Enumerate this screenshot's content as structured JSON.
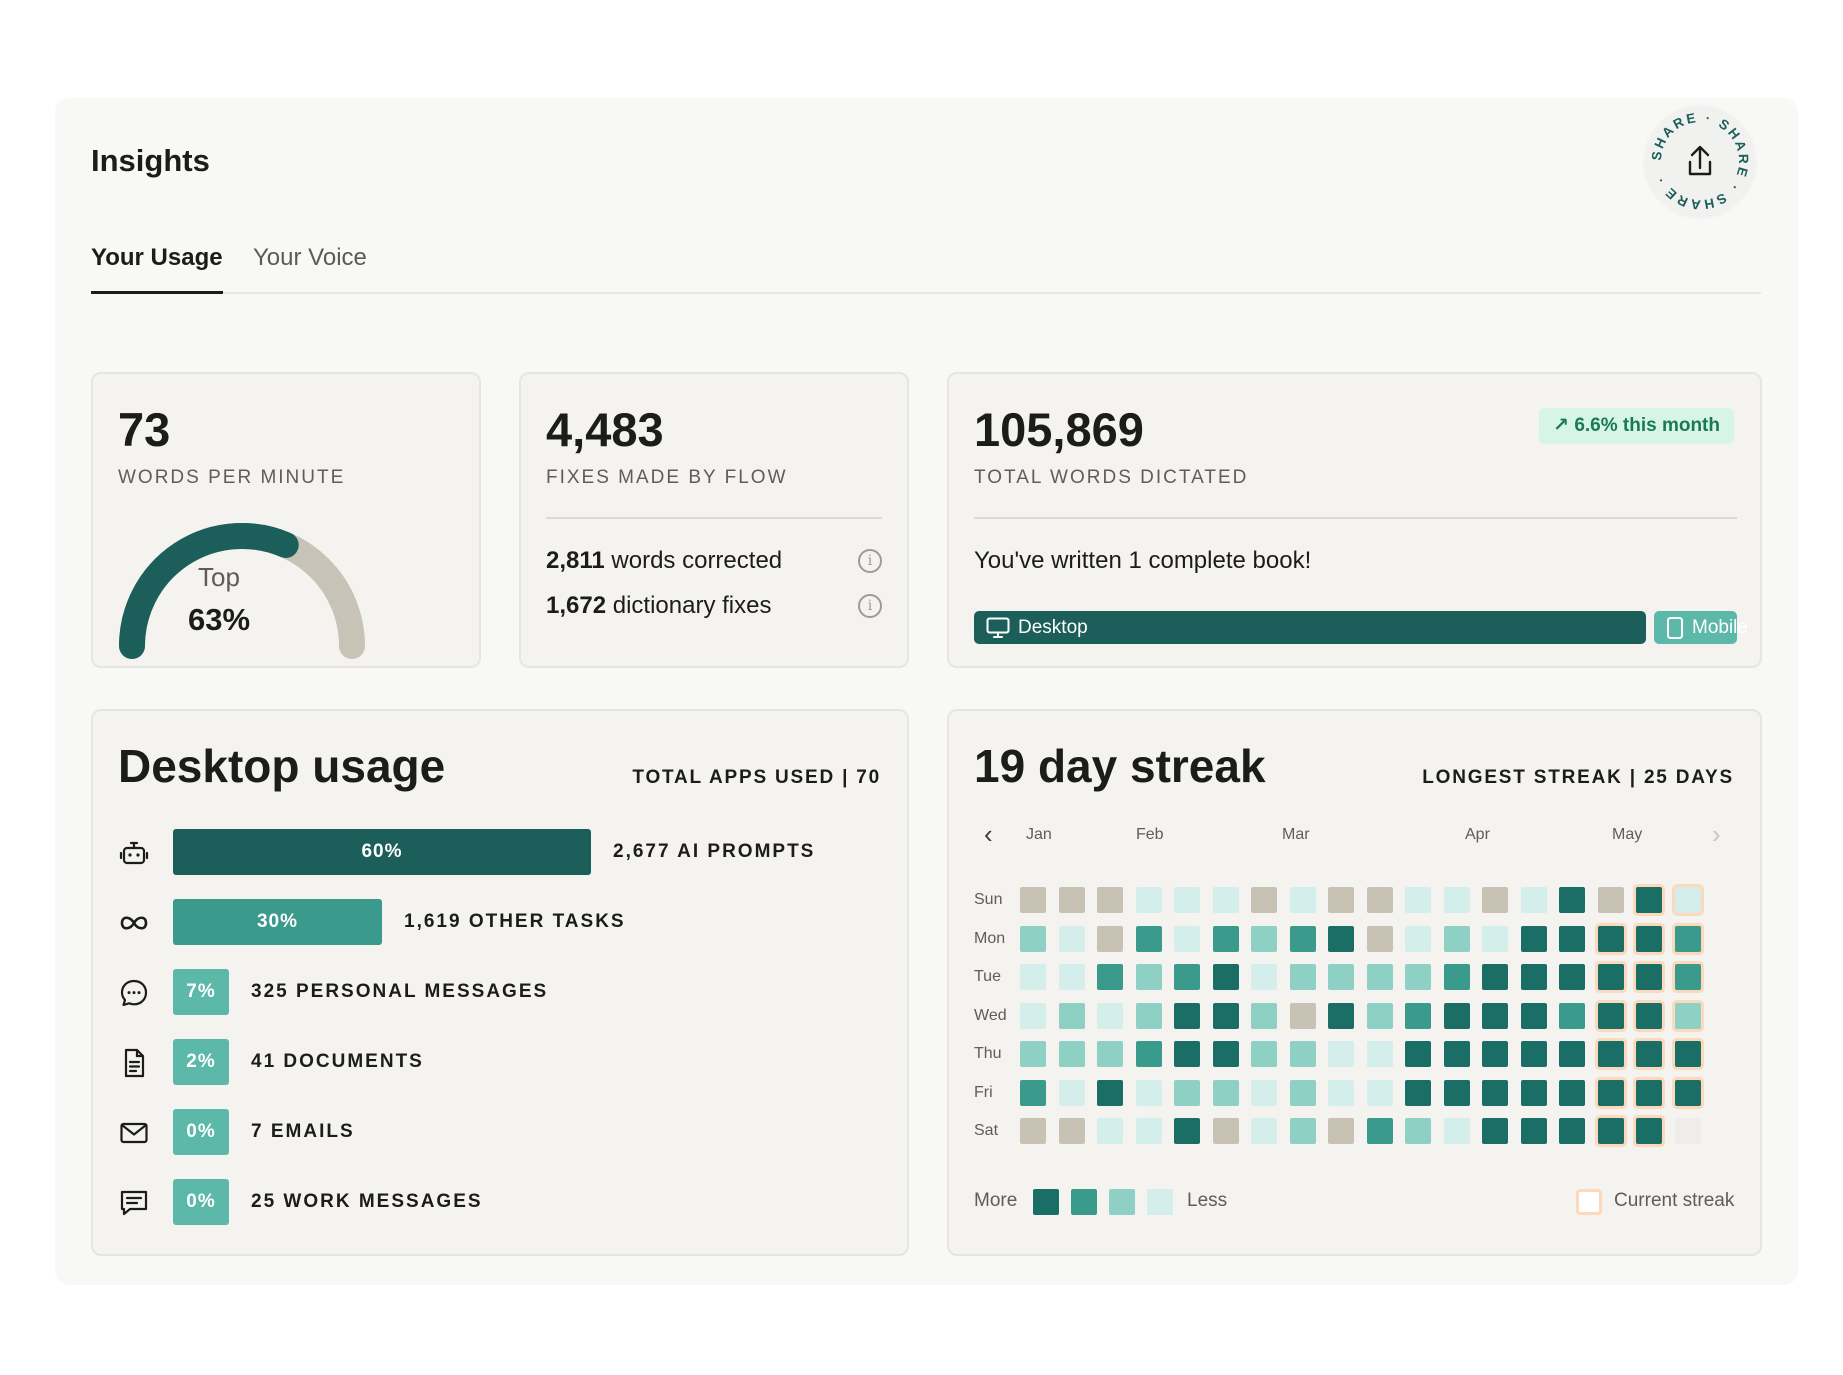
{
  "header": {
    "title": "Insights",
    "share_label": "SHARE · SHARE · SHARE ·"
  },
  "tabs": [
    {
      "label": "Your Usage",
      "active": true
    },
    {
      "label": "Your Voice",
      "active": false
    }
  ],
  "wpm": {
    "value": "73",
    "label": "WORDS PER MINUTE",
    "rank_prefix": "Top",
    "rank": "63%",
    "rank_fraction": 0.63
  },
  "fixes": {
    "value": "4,483",
    "label": "FIXES MADE BY FLOW",
    "rows": [
      {
        "count": "2,811",
        "text": "words corrected"
      },
      {
        "count": "1,672",
        "text": "dictionary fixes"
      }
    ],
    "info_glyph": "i"
  },
  "words": {
    "value": "105,869",
    "label": "TOTAL WORDS DICTATED",
    "badge": "6.6% this month",
    "book_text": "You've written 1 complete book!",
    "desktop_label": "Desktop",
    "mobile_label": "Mobile",
    "desktop_share": 0.9
  },
  "desktop_usage": {
    "title": "Desktop usage",
    "total": "TOTAL APPS USED | 70",
    "apps": [
      {
        "icon": "robot-icon",
        "percent": "60%",
        "value": 0.6,
        "label": "2,677 AI PROMPTS"
      },
      {
        "icon": "infinity-icon",
        "percent": "30%",
        "value": 0.3,
        "label": "1,619 OTHER TASKS"
      },
      {
        "icon": "chat-bubble-icon",
        "percent": "7%",
        "value": 0.07,
        "label": "325 PERSONAL MESSAGES"
      },
      {
        "icon": "document-icon",
        "percent": "2%",
        "value": 0.02,
        "label": "41 DOCUMENTS"
      },
      {
        "icon": "envelope-icon",
        "percent": "0%",
        "value": 0.0,
        "label": "7 EMAILS"
      },
      {
        "icon": "message-square-icon",
        "percent": "0%",
        "value": 0.0,
        "label": "25 WORK MESSAGES"
      }
    ]
  },
  "streak": {
    "title": "19 day streak",
    "longest": "LONGEST STREAK | 25 DAYS",
    "months": [
      "Jan",
      "Feb",
      "Mar",
      "Apr",
      "May"
    ],
    "days": [
      "Sun",
      "Mon",
      "Tue",
      "Wed",
      "Thu",
      "Fri",
      "Sat"
    ],
    "levels": [
      [
        "g",
        "g",
        "g",
        "1",
        "1",
        "1",
        "g",
        "1",
        "g",
        "g",
        "1",
        "1",
        "g",
        "1",
        "4",
        "g",
        "4",
        "1"
      ],
      [
        "2",
        "1",
        "g",
        "3",
        "1",
        "3",
        "2",
        "3",
        "4",
        "g",
        "1",
        "2",
        "1",
        "4",
        "4",
        "4",
        "4",
        "3"
      ],
      [
        "1",
        "1",
        "3",
        "2",
        "3",
        "4",
        "1",
        "2",
        "2",
        "2",
        "2",
        "3",
        "4",
        "4",
        "4",
        "4",
        "4",
        "3"
      ],
      [
        "1",
        "2",
        "1",
        "2",
        "4",
        "4",
        "2",
        "g",
        "4",
        "2",
        "3",
        "4",
        "4",
        "4",
        "3",
        "4",
        "4",
        "2"
      ],
      [
        "2",
        "2",
        "2",
        "3",
        "4",
        "4",
        "2",
        "2",
        "1",
        "1",
        "4",
        "4",
        "4",
        "4",
        "4",
        "4",
        "4",
        "4"
      ],
      [
        "3",
        "1",
        "4",
        "1",
        "2",
        "2",
        "1",
        "2",
        "1",
        "1",
        "4",
        "4",
        "4",
        "4",
        "4",
        "4",
        "4",
        "4"
      ],
      [
        "g",
        "g",
        "1",
        "1",
        "4",
        "g",
        "1",
        "2",
        "g",
        "3",
        "2",
        "1",
        "4",
        "4",
        "4",
        "4",
        "4",
        "e"
      ]
    ],
    "current_streak": [
      [
        0,
        16
      ],
      [
        0,
        17
      ],
      [
        1,
        15
      ],
      [
        1,
        16
      ],
      [
        1,
        17
      ],
      [
        2,
        15
      ],
      [
        2,
        16
      ],
      [
        2,
        17
      ],
      [
        3,
        15
      ],
      [
        3,
        16
      ],
      [
        3,
        17
      ],
      [
        4,
        15
      ],
      [
        4,
        16
      ],
      [
        4,
        17
      ],
      [
        5,
        15
      ],
      [
        5,
        16
      ],
      [
        5,
        17
      ],
      [
        6,
        15
      ],
      [
        6,
        16
      ]
    ],
    "colors": {
      "g": "#c8c2b5",
      "1": "#d3eeeb",
      "2": "#8ed0c3",
      "3": "#3a9a8c",
      "4": "#1b6e65",
      "e": "#eeede9"
    },
    "legend_more": "More",
    "legend_less": "Less",
    "legend_current": "Current streak"
  },
  "colors": {
    "dark_teal": "#1b5e5a",
    "mid_teal": "#3a9a8c",
    "light_teal": "#5cb8a8",
    "gauge_track": "#c8c3b7"
  }
}
